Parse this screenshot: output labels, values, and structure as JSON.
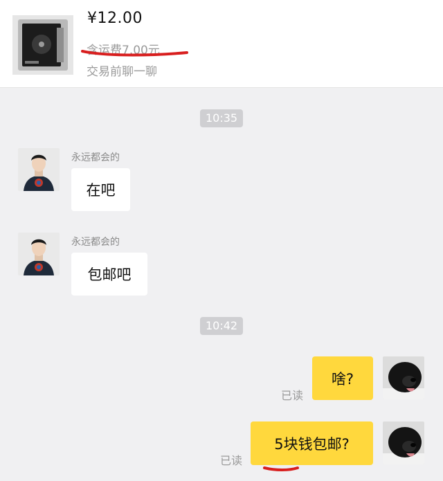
{
  "product": {
    "price": "¥12.00",
    "shipping": "含运费7.00元",
    "trade_hint": "交易前聊一聊"
  },
  "messages": [
    {
      "time": "10:35"
    },
    {
      "sender": "永远都会的",
      "text": "在吧"
    },
    {
      "sender": "永远都会的",
      "text": "包邮吧"
    },
    {
      "time": "10:42"
    },
    {
      "text": "啥?",
      "status": "已读"
    },
    {
      "text": "5块钱包邮?",
      "status": "已读"
    }
  ],
  "colors": {
    "outgoing_bubble": "#ffd83d",
    "incoming_bubble": "#ffffff",
    "annotation": "#d81e1e"
  }
}
